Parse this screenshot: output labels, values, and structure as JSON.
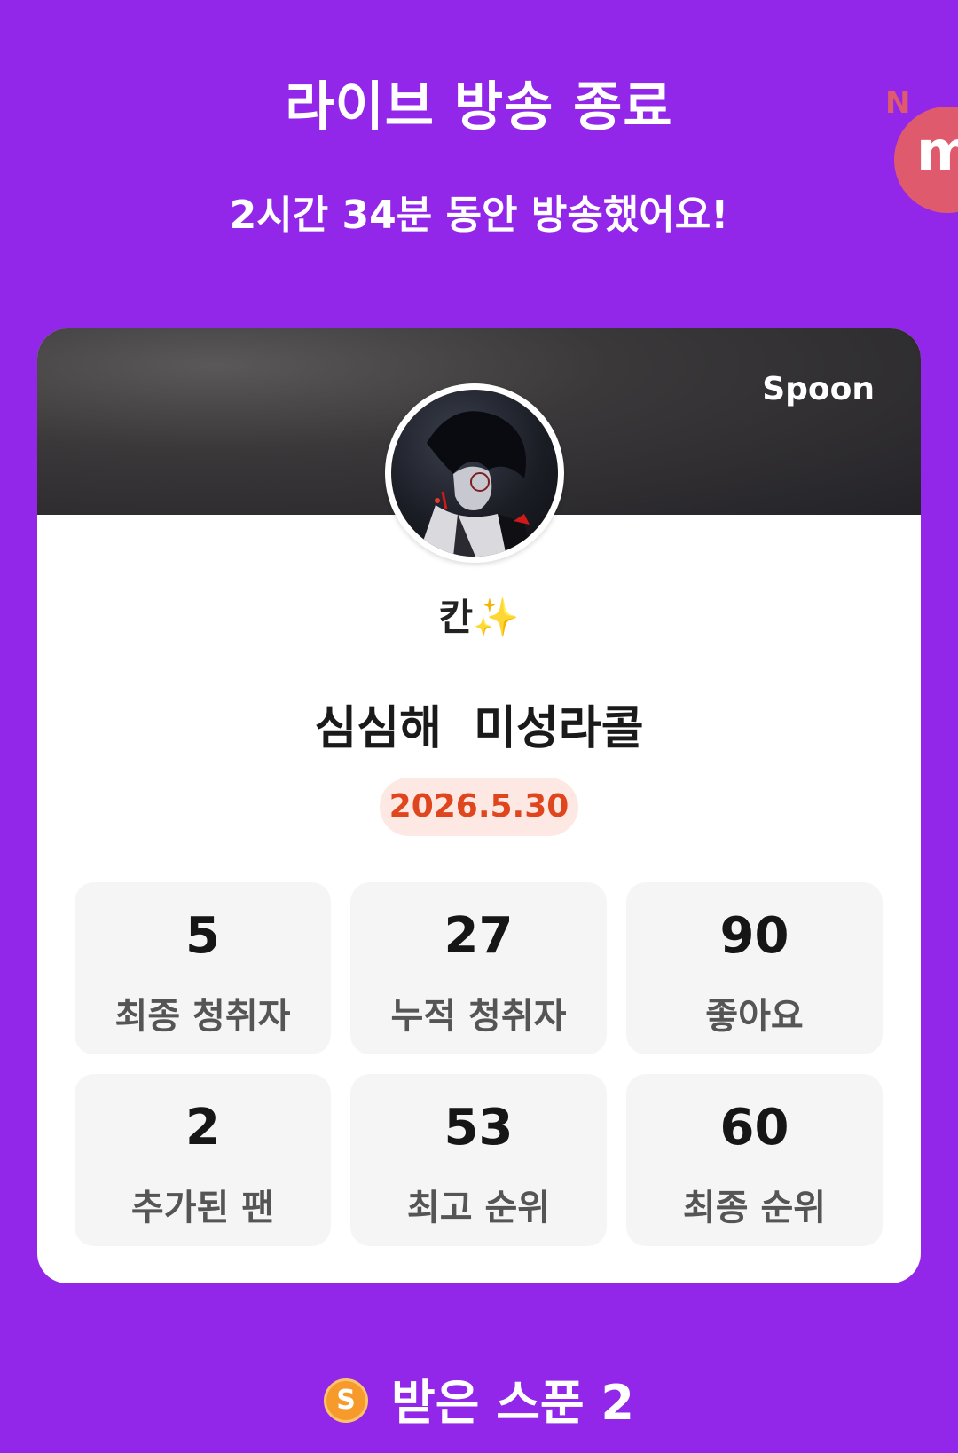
{
  "header": {
    "title": "라이브 방송 종료",
    "subtitle": "2시간 34분 동안 방송했어요!"
  },
  "floating_badge": {
    "letter": "m",
    "corner": "N"
  },
  "card": {
    "brand": "Spoon",
    "nickname": "칸",
    "nickname_emoji": "✨",
    "live_title": "심심해  미성라콜",
    "date": "2026.5.30"
  },
  "stats": [
    {
      "value": "5",
      "label": "최종 청취자"
    },
    {
      "value": "27",
      "label": "누적 청취자"
    },
    {
      "value": "90",
      "label": "좋아요"
    },
    {
      "value": "2",
      "label": "추가된 팬"
    },
    {
      "value": "53",
      "label": "최고 순위"
    },
    {
      "value": "60",
      "label": "최종 순위"
    }
  ],
  "spoons": {
    "coin_letter": "S",
    "label": "받은 스푼",
    "count": "2"
  },
  "colors": {
    "background": "#9227E9",
    "date_text": "#E0461E",
    "date_bg": "#FDE8E4",
    "coin": "#F59A2B",
    "badge": "#E05A6E"
  }
}
